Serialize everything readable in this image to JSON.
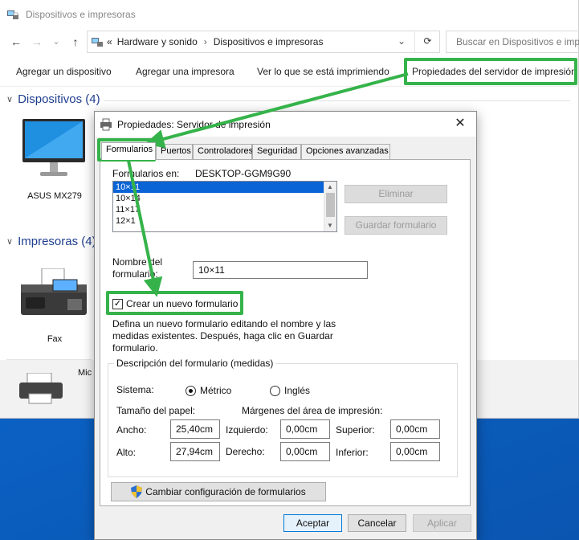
{
  "explorer": {
    "title": "Dispositivos e impresoras",
    "address": {
      "prefix": "«",
      "crumb1": "Hardware y sonido",
      "separator": "›",
      "crumb2": "Dispositivos e impresoras",
      "dropdown": "⌄"
    },
    "nav": {
      "back": "←",
      "forward": "→",
      "recent": "⌄",
      "up": "↑",
      "refresh": "⟳"
    },
    "search_placeholder": "Buscar en Dispositivos e impresoras",
    "commands": [
      "Agregar un dispositivo",
      "Agregar una impresora",
      "Ver lo que se está imprimiendo",
      "Propiedades del servidor de impresión"
    ],
    "sections": {
      "devices": "Dispositivos (4)",
      "printers": "Impresoras (4)"
    },
    "devices": [
      {
        "label": "ASUS MX279",
        "icon": "monitor-icon"
      }
    ],
    "printers": [
      {
        "label": "Fax",
        "icon": "fax-icon"
      },
      {
        "label": "Mic",
        "icon": "printer-icon"
      }
    ]
  },
  "dialog": {
    "title": "Propiedades: Servidor de impresión",
    "close": "✕",
    "tabs": [
      "Formularios",
      "Puertos",
      "Controladores",
      "Seguridad",
      "Opciones avanzadas"
    ],
    "active_tab": "Formularios",
    "forms_on_label": "Formularios en:",
    "server_name": "DESKTOP-GGM9G90",
    "form_list": [
      "10×11",
      "10×14",
      "11×17",
      "12×1"
    ],
    "selected_form": "10×11",
    "delete_button": "Eliminar",
    "save_form_button": "Guardar formulario",
    "form_name_label": "Nombre del formulario:",
    "form_name_value": "10×11",
    "create_new_form_label": "Crear un nuevo formulario",
    "create_new_form_checked": true,
    "help_text": "Defina un nuevo formulario editando el nombre y las medidas existentes. Después, haga clic en Guardar formulario.",
    "description_group": "Descripción del formulario (medidas)",
    "system_label": "Sistema:",
    "metric_label": "Métrico",
    "metric_selected": true,
    "english_label": "Inglés",
    "paper_size_label": "Tamaño del papel:",
    "margins_label": "Márgenes del área de impresión:",
    "width_label": "Ancho:",
    "width_value": "25,40cm",
    "height_label": "Alto:",
    "height_value": "27,94cm",
    "left_label": "Izquierdo:",
    "left_value": "0,00cm",
    "right_label": "Derecho:",
    "right_value": "0,00cm",
    "top_label": "Superior:",
    "top_value": "0,00cm",
    "bottom_label": "Inferior:",
    "bottom_value": "0,00cm",
    "change_settings_button": "Cambiar configuración de formularios",
    "ok_button": "Aceptar",
    "cancel_button": "Cancelar",
    "apply_button": "Aplicar"
  },
  "annotation_color": "#35b34a"
}
